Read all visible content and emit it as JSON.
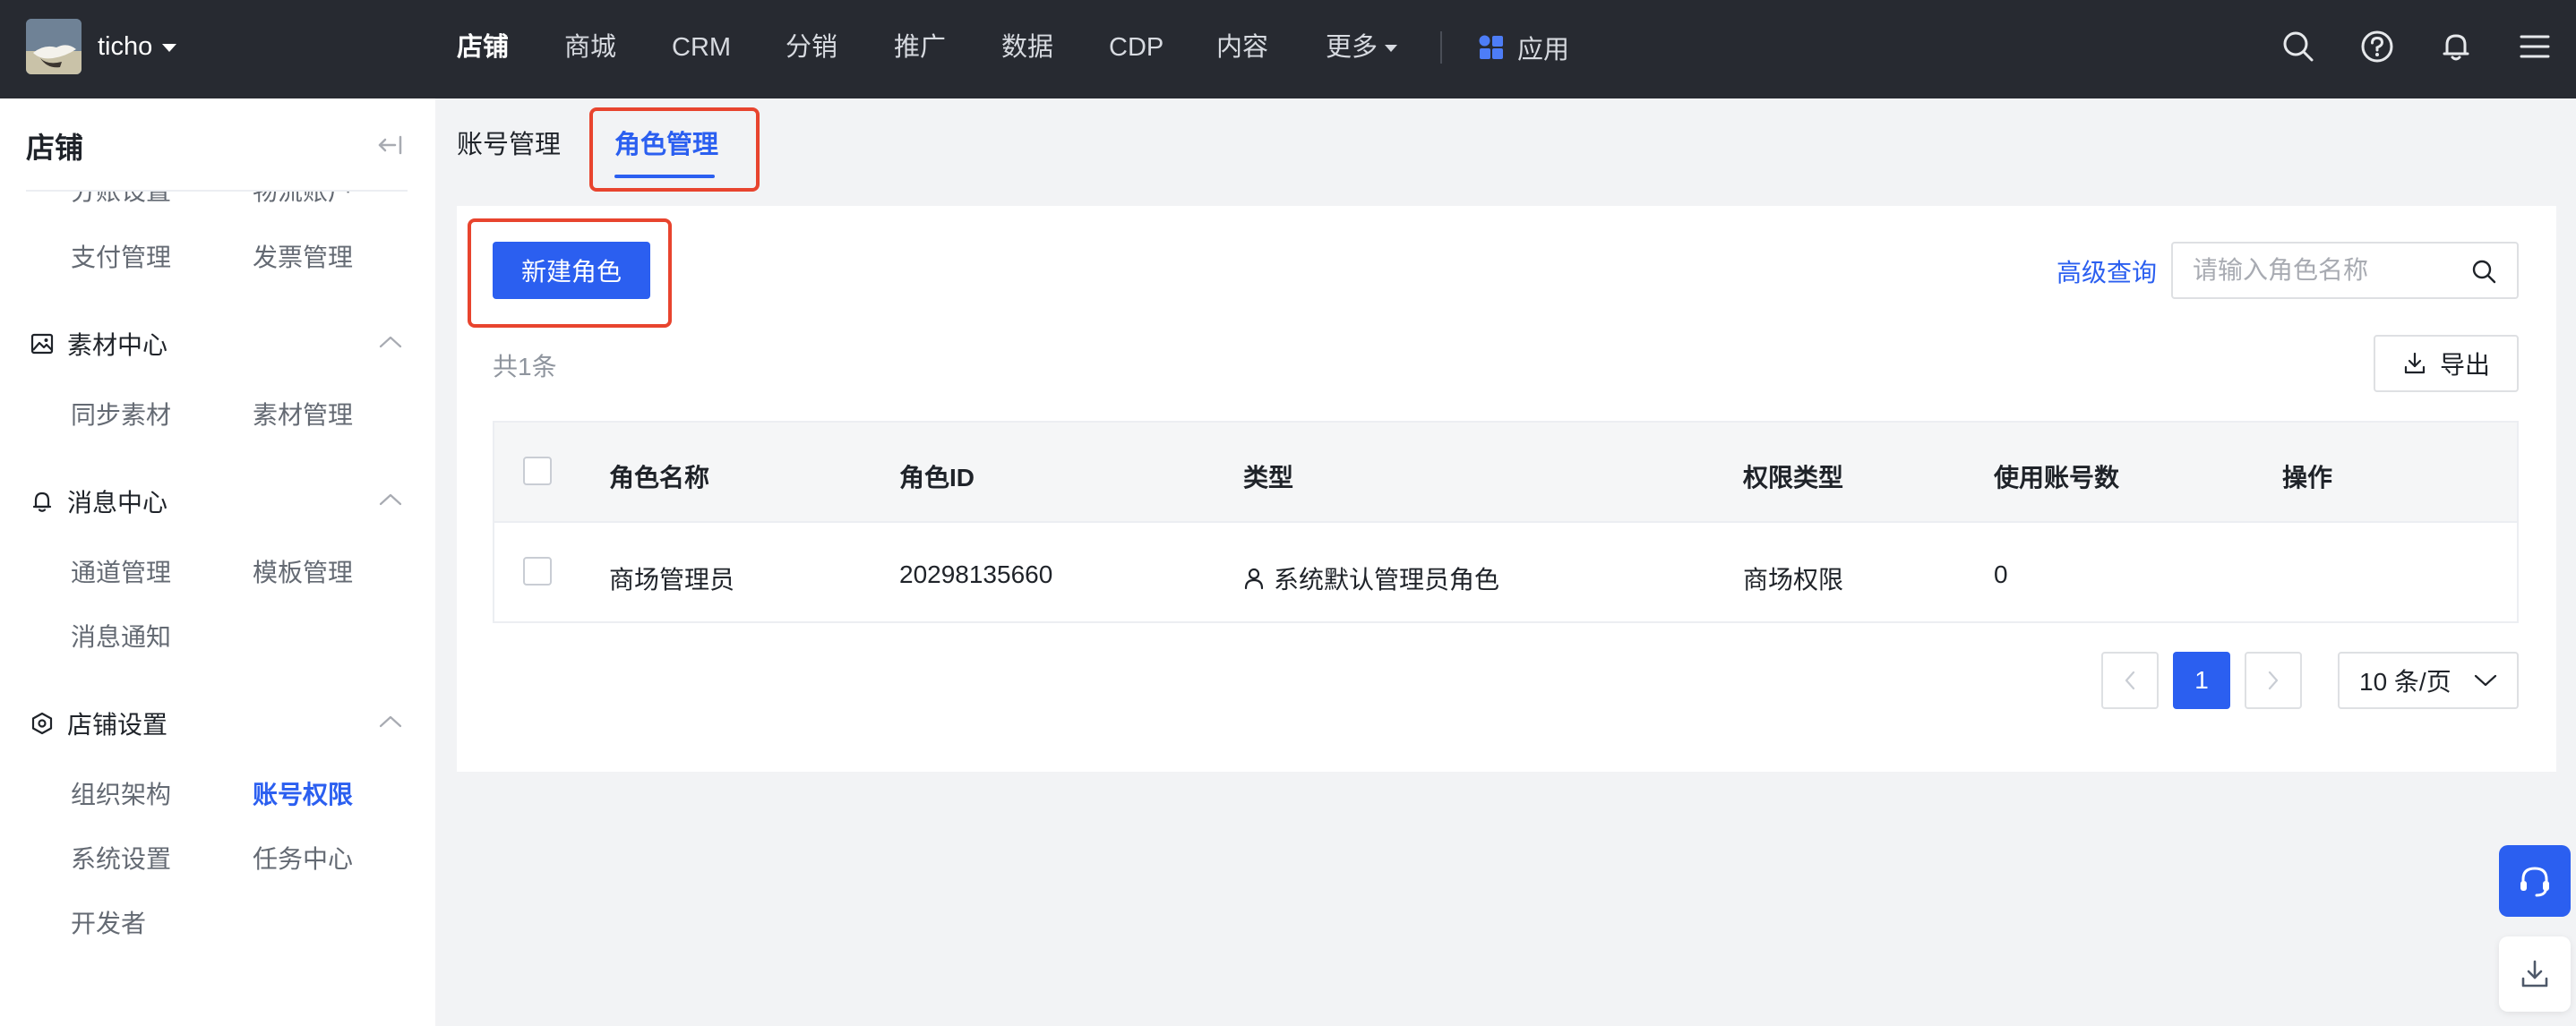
{
  "header": {
    "account_name": "ticho",
    "nav": [
      {
        "label": "店铺",
        "active": true
      },
      {
        "label": "商城"
      },
      {
        "label": "CRM"
      },
      {
        "label": "分销"
      },
      {
        "label": "推广"
      },
      {
        "label": "数据"
      },
      {
        "label": "CDP"
      },
      {
        "label": "内容"
      },
      {
        "label": "更多"
      }
    ],
    "app_label": "应用",
    "icons": [
      "search-icon",
      "help-icon",
      "bell-icon",
      "menu-icon"
    ]
  },
  "sidebar": {
    "title": "店铺",
    "clipped_items": [
      "分账设置",
      "物流账户"
    ],
    "pay_items": [
      "支付管理",
      "发票管理"
    ],
    "groups": [
      {
        "label": "素材中心",
        "icon": "image-icon",
        "items": [
          "同步素材",
          "素材管理"
        ]
      },
      {
        "label": "消息中心",
        "icon": "bell-icon",
        "items": [
          "通道管理",
          "模板管理",
          "消息通知"
        ]
      },
      {
        "label": "店铺设置",
        "icon": "hexagon-settings-icon",
        "items": [
          "组织架构",
          "账号权限",
          "系统设置",
          "任务中心",
          "开发者"
        ]
      }
    ],
    "active_item": "账号权限"
  },
  "tabs": [
    {
      "label": "账号管理"
    },
    {
      "label": "角色管理",
      "active": true
    }
  ],
  "toolbar": {
    "new_role": "新建角色",
    "advanced_search": "高级查询",
    "search_placeholder": "请输入角色名称",
    "total": "共1条",
    "export": "导出"
  },
  "table": {
    "columns": [
      "角色名称",
      "角色ID",
      "类型",
      "权限类型",
      "使用账号数",
      "操作"
    ],
    "rows": [
      {
        "name": "商场管理员",
        "id": "20298135660",
        "type": "系统默认管理员角色",
        "type_icon": "user-icon",
        "permission": "商场权限",
        "account_count": "0",
        "actions": ""
      }
    ]
  },
  "pagination": {
    "current_page": "1",
    "page_size": "10 条/页"
  },
  "colors": {
    "topbar": "#272a31",
    "primary": "#2b5ff0",
    "highlight_box": "#e8442e"
  }
}
